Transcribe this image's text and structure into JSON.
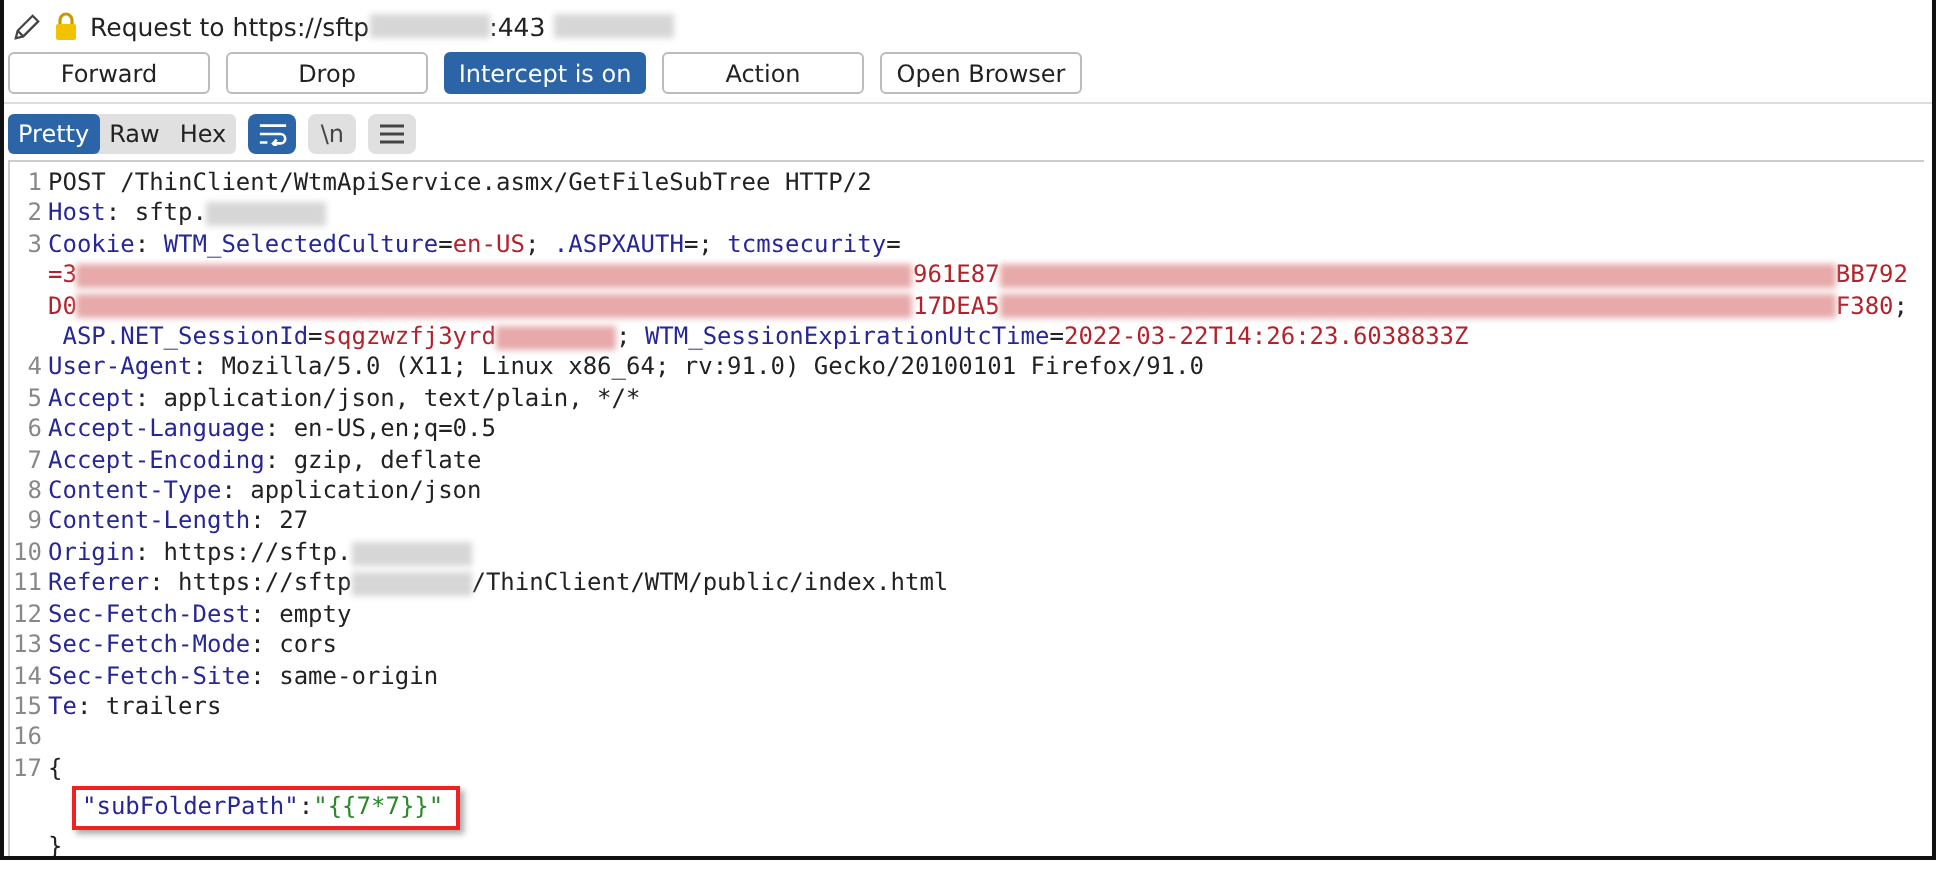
{
  "title": {
    "segments": [
      {
        "kind": "plain",
        "text": "Request to https://sftp"
      },
      {
        "kind": "redacted"
      },
      {
        "kind": "plain",
        "text": ":443 "
      },
      {
        "kind": "redacted"
      }
    ]
  },
  "buttons": [
    {
      "label": "Forward",
      "selected": false
    },
    {
      "label": "Drop",
      "selected": false
    },
    {
      "label": "Intercept is on",
      "selected": true
    },
    {
      "label": "Action",
      "selected": false
    },
    {
      "label": "Open Browser",
      "selected": false
    }
  ],
  "view_tabs": [
    {
      "label": "Pretty",
      "selected": true
    },
    {
      "label": "Raw",
      "selected": false
    },
    {
      "label": "Hex",
      "selected": false
    }
  ],
  "view_toggles": [
    {
      "kind": "wrap",
      "on": true
    },
    {
      "kind": "newline",
      "label": "\\n",
      "on": false
    },
    {
      "kind": "menu",
      "on": false
    }
  ],
  "editor": {
    "lines": [
      {
        "number": "1",
        "segments": [
          {
            "kind": "plain",
            "text": "POST /ThinClient/WtmApiService.asmx/GetFileSubTree HTTP/2"
          }
        ]
      },
      {
        "number": "2",
        "segments": [
          {
            "kind": "key",
            "text": "Host"
          },
          {
            "kind": "plain",
            "text": ": sftp."
          },
          {
            "kind": "redacted"
          }
        ]
      },
      {
        "number": "3",
        "segments": [
          {
            "kind": "key",
            "text": "Cookie"
          },
          {
            "kind": "plain",
            "text": ": "
          },
          {
            "kind": "key",
            "text": "WTM_SelectedCulture"
          },
          {
            "kind": "plain",
            "text": "="
          },
          {
            "kind": "value",
            "text": "en-US"
          },
          {
            "kind": "plain",
            "text": "; "
          },
          {
            "kind": "key",
            "text": ".ASPXAUTH"
          },
          {
            "kind": "plain",
            "text": "=; "
          },
          {
            "kind": "key",
            "text": "tcmsecurity"
          },
          {
            "kind": "plain",
            "text": "="
          }
        ]
      },
      {
        "wrapped": true,
        "segments": [
          {
            "kind": "value",
            "text": "=3"
          },
          {
            "kind": "redacted-value"
          },
          {
            "kind": "value",
            "text": "961E87"
          },
          {
            "kind": "redacted-value"
          },
          {
            "kind": "value",
            "text": "BB792"
          }
        ]
      },
      {
        "wrapped": true,
        "segments": [
          {
            "kind": "value",
            "text": "D0"
          },
          {
            "kind": "redacted-value"
          },
          {
            "kind": "value",
            "text": "17DEA5"
          },
          {
            "kind": "redacted-value"
          },
          {
            "kind": "value",
            "text": "F380"
          },
          {
            "kind": "plain",
            "text": ";"
          }
        ]
      },
      {
        "segments": [
          {
            "kind": "indent"
          },
          {
            "kind": "key",
            "text": "ASP.NET_SessionId"
          },
          {
            "kind": "plain",
            "text": "="
          },
          {
            "kind": "value",
            "text": "sqgzwzfj3yrd"
          },
          {
            "kind": "redacted-value"
          },
          {
            "kind": "plain",
            "text": "; "
          },
          {
            "kind": "key",
            "text": "WTM_SessionExpirationUtcTime"
          },
          {
            "kind": "plain",
            "text": "="
          },
          {
            "kind": "value",
            "text": "2022-03-22T14:26:23.6038833Z"
          }
        ]
      },
      {
        "number": "4",
        "segments": [
          {
            "kind": "key",
            "text": "User-Agent"
          },
          {
            "kind": "plain",
            "text": ": Mozilla/5.0 (X11; Linux x86_64; rv:91.0) Gecko/20100101 Firefox/91.0"
          }
        ]
      },
      {
        "number": "5",
        "segments": [
          {
            "kind": "key",
            "text": "Accept"
          },
          {
            "kind": "plain",
            "text": ": application/json, text/plain, */*"
          }
        ]
      },
      {
        "number": "6",
        "segments": [
          {
            "kind": "key",
            "text": "Accept-Language"
          },
          {
            "kind": "plain",
            "text": ": en-US,en;q=0.5"
          }
        ]
      },
      {
        "number": "7",
        "segments": [
          {
            "kind": "key",
            "text": "Accept-Encoding"
          },
          {
            "kind": "plain",
            "text": ": gzip, deflate"
          }
        ]
      },
      {
        "number": "8",
        "segments": [
          {
            "kind": "key",
            "text": "Content-Type"
          },
          {
            "kind": "plain",
            "text": ": application/json"
          }
        ]
      },
      {
        "number": "9",
        "segments": [
          {
            "kind": "key",
            "text": "Content-Length"
          },
          {
            "kind": "plain",
            "text": ": 27"
          }
        ]
      },
      {
        "number": "10",
        "segments": [
          {
            "kind": "key",
            "text": "Origin"
          },
          {
            "kind": "plain",
            "text": ": https://sftp."
          },
          {
            "kind": "redacted"
          }
        ]
      },
      {
        "number": "11",
        "segments": [
          {
            "kind": "key",
            "text": "Referer"
          },
          {
            "kind": "plain",
            "text": ": https://sftp"
          },
          {
            "kind": "redacted"
          },
          {
            "kind": "plain",
            "text": "/ThinClient/WTM/public/index.html"
          }
        ]
      },
      {
        "number": "12",
        "segments": [
          {
            "kind": "key",
            "text": "Sec-Fetch-Dest"
          },
          {
            "kind": "plain",
            "text": ": empty"
          }
        ]
      },
      {
        "number": "13",
        "segments": [
          {
            "kind": "key",
            "text": "Sec-Fetch-Mode"
          },
          {
            "kind": "plain",
            "text": ": cors"
          }
        ]
      },
      {
        "number": "14",
        "segments": [
          {
            "kind": "key",
            "text": "Sec-Fetch-Site"
          },
          {
            "kind": "plain",
            "text": ": same-origin"
          }
        ]
      },
      {
        "number": "15",
        "segments": [
          {
            "kind": "key",
            "text": "Te"
          },
          {
            "kind": "plain",
            "text": ": trailers"
          }
        ]
      },
      {
        "number": "16"
      },
      {
        "number": "17",
        "segments": [
          {
            "kind": "plain",
            "text": "{"
          }
        ]
      },
      {
        "highlighted": true,
        "segments": [
          {
            "kind": "json-key",
            "text": "\"subFolderPath\""
          },
          {
            "kind": "plain",
            "text": ":"
          },
          {
            "kind": "json-value",
            "text": "\"{{7*7}}\""
          }
        ]
      },
      {
        "segments": [
          {
            "kind": "plain",
            "text": "}"
          }
        ]
      }
    ]
  }
}
